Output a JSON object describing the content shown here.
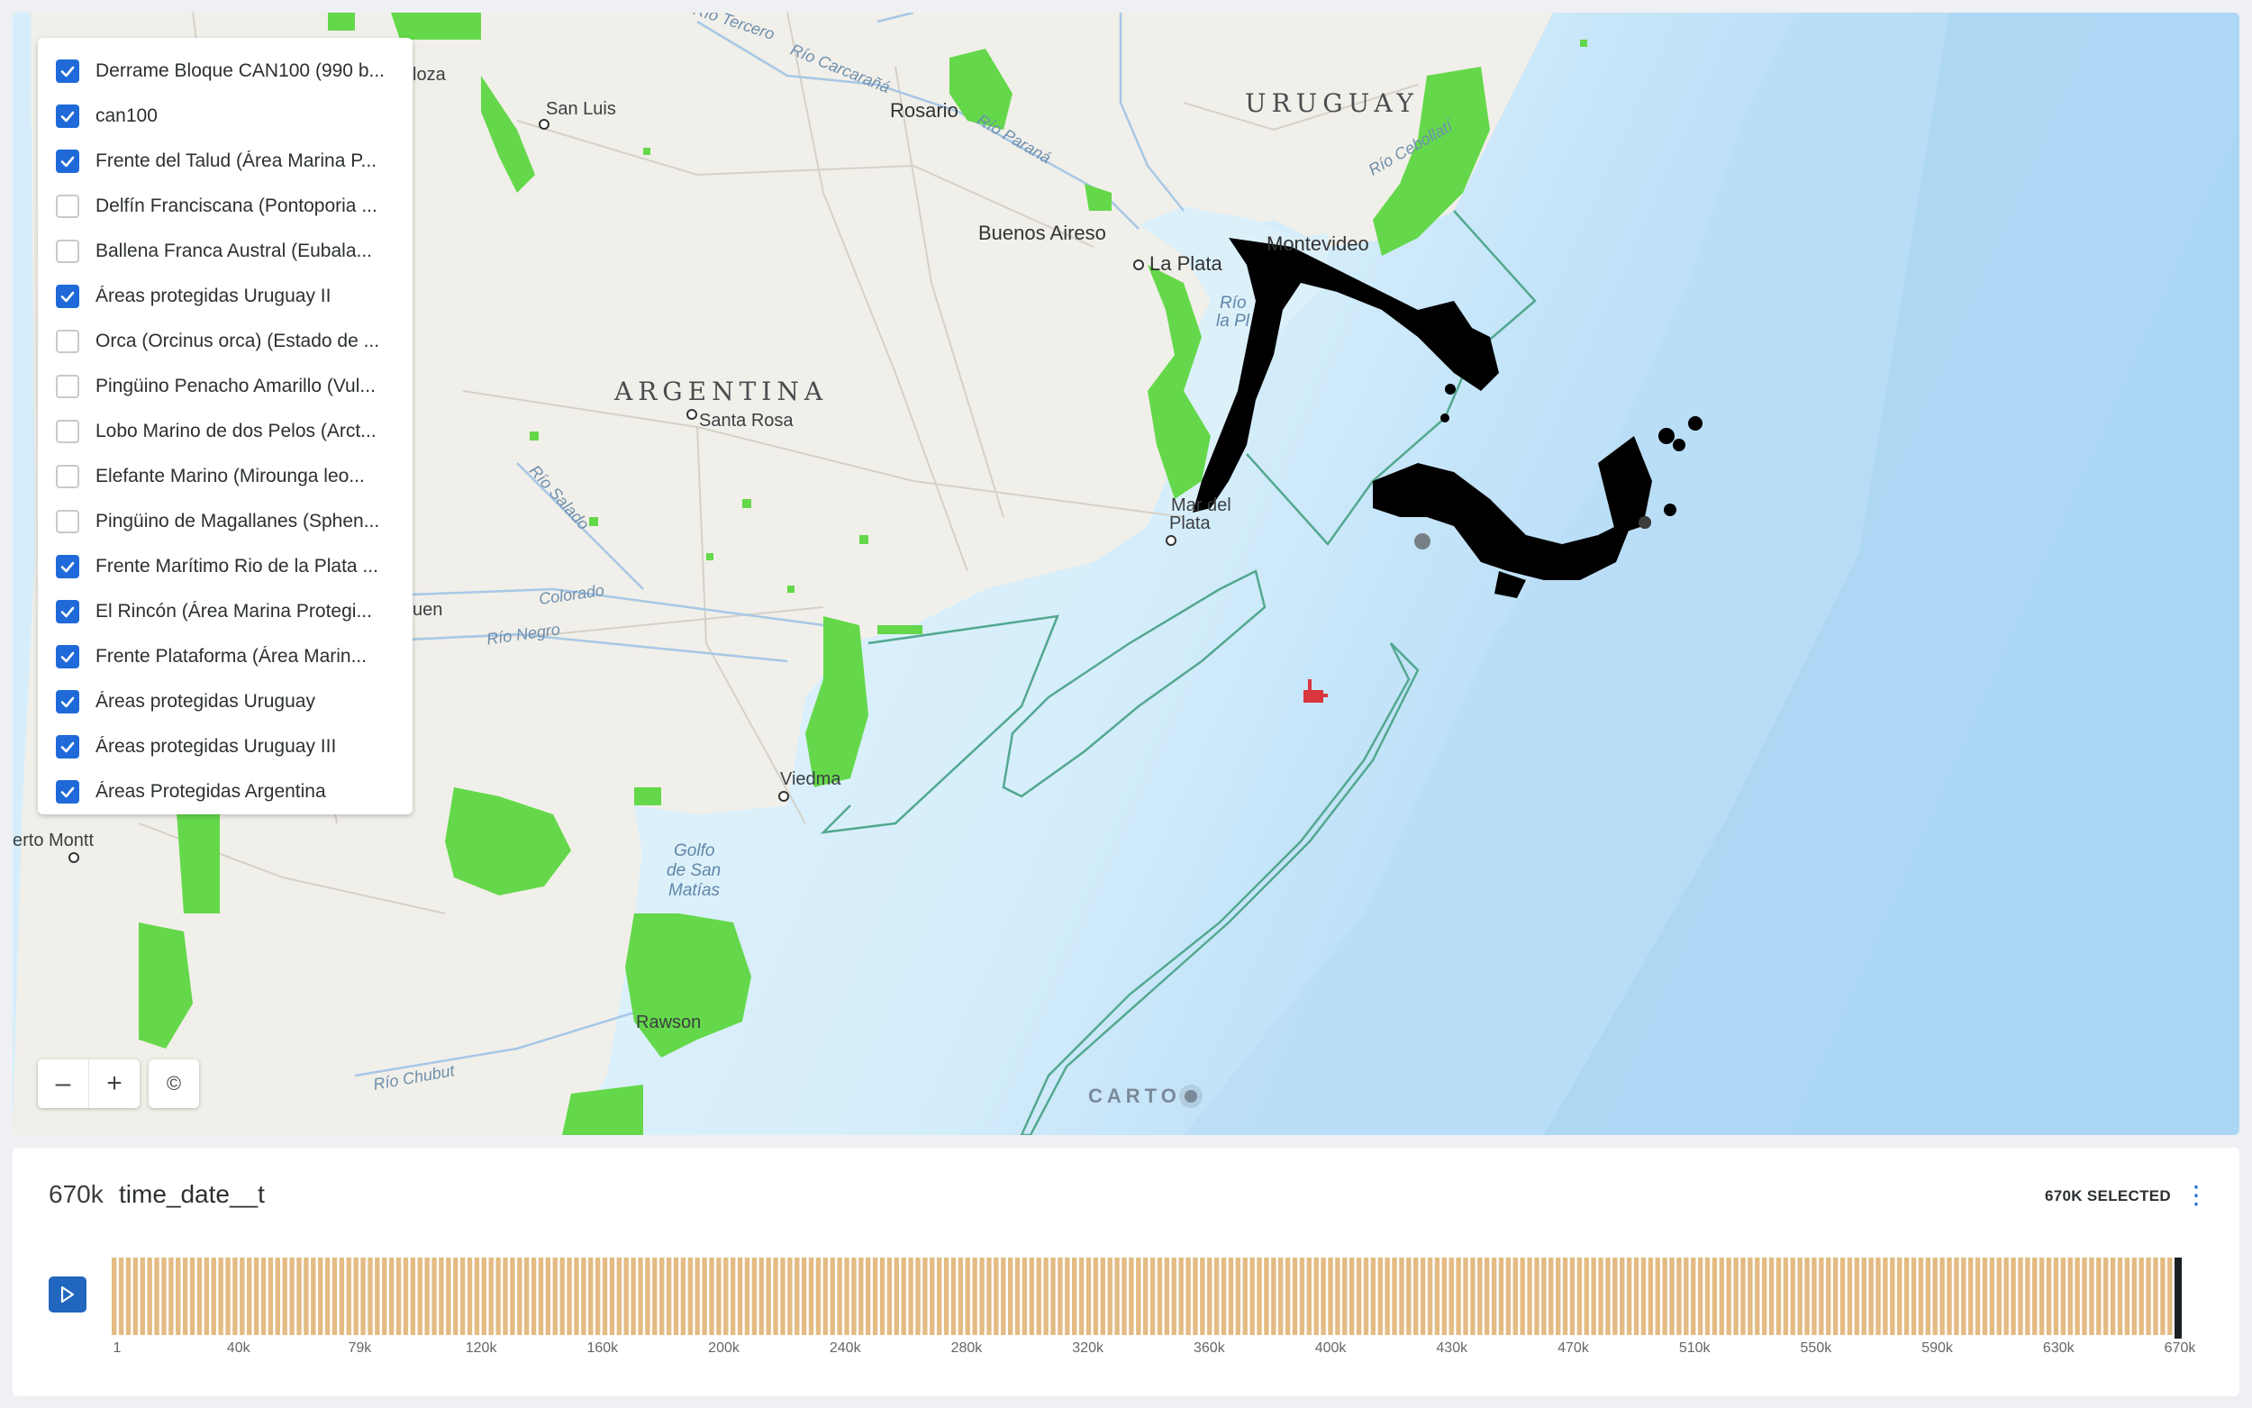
{
  "layers": [
    {
      "label": "Derrame Bloque CAN100 (990 b...",
      "checked": true
    },
    {
      "label": "can100",
      "checked": true
    },
    {
      "label": "Frente del Talud (Área Marina P...",
      "checked": true
    },
    {
      "label": "Delfín Franciscana (Pontoporia ...",
      "checked": false
    },
    {
      "label": "Ballena Franca Austral (Eubala...",
      "checked": false
    },
    {
      "label": "Áreas protegidas Uruguay II",
      "checked": true
    },
    {
      "label": "Orca (Orcinus orca) (Estado de ...",
      "checked": false
    },
    {
      "label": "Pingüino Penacho Amarillo (Vul...",
      "checked": false
    },
    {
      "label": "Lobo Marino de dos Pelos (Arct...",
      "checked": false
    },
    {
      "label": "Elefante Marino (Mirounga leo...",
      "checked": false
    },
    {
      "label": "Pingüino de Magallanes (Sphen...",
      "checked": false
    },
    {
      "label": "Frente Marítimo Rio de la Plata ...",
      "checked": true
    },
    {
      "label": "El Rincón (Área Marina Protegi...",
      "checked": true
    },
    {
      "label": "Frente Plataforma (Área Marin...",
      "checked": true
    },
    {
      "label": "Áreas protegidas Uruguay",
      "checked": true
    },
    {
      "label": "Áreas protegidas Uruguay III",
      "checked": true
    },
    {
      "label": "Áreas Protegidas Argentina",
      "checked": true
    }
  ],
  "map": {
    "places": {
      "uruguay": "URUGUAY",
      "argentina": "ARGENTINA",
      "rosario": "Rosario",
      "buenos_aires": "Buenos Aireso",
      "la_plata": "La Plata",
      "montevideo": "Montevideo",
      "san_luis": "San Luis",
      "santa_rosa": "Santa Rosa",
      "mar_del_plata_1": "Mar del",
      "mar_del_plata_2": "Plata",
      "viedma": "Viedma",
      "rawson": "Rawson",
      "puerto_montt": "erto Montt",
      "loza": "loza",
      "uen": "uen",
      "rio_la_plata_1": "Río",
      "rio_la_plata_2": "la Pl",
      "golfo_1": "Golfo",
      "golfo_2": "de San",
      "golfo_3": "Matías",
      "rio_tercero": "Río Tercero",
      "rio_carcarana": "Río Carcarañá",
      "rio_parana": "Río Paraná",
      "rio_cebollati": "Río Cebollatí",
      "rio_salado": "Río Salado",
      "colorado": "Colorado",
      "rio_negro": "Río Negro",
      "rio_chubut": "Río Chubut"
    },
    "attribution_button": "©",
    "zoom_out": "–",
    "zoom_in": "+",
    "carto_logo": "CARTO",
    "colors": {
      "protected_area": "#64d84a",
      "marine_area_outline": "#53a890",
      "spill": "#000000",
      "ocean_shallow": "#dcf0fa",
      "ocean_deep": "#a6d4f4",
      "land": "#f1efe9"
    }
  },
  "timeline": {
    "count": "670k",
    "field": "time_date__t",
    "selected": "670K SELECTED",
    "menu_icon": "⋮",
    "bar_color": "#e3bb83",
    "axis_ticks": [
      "1",
      "40k",
      "79k",
      "120k",
      "160k",
      "200k",
      "240k",
      "280k",
      "320k",
      "360k",
      "400k",
      "430k",
      "470k",
      "510k",
      "550k",
      "590k",
      "630k",
      "670k"
    ]
  }
}
